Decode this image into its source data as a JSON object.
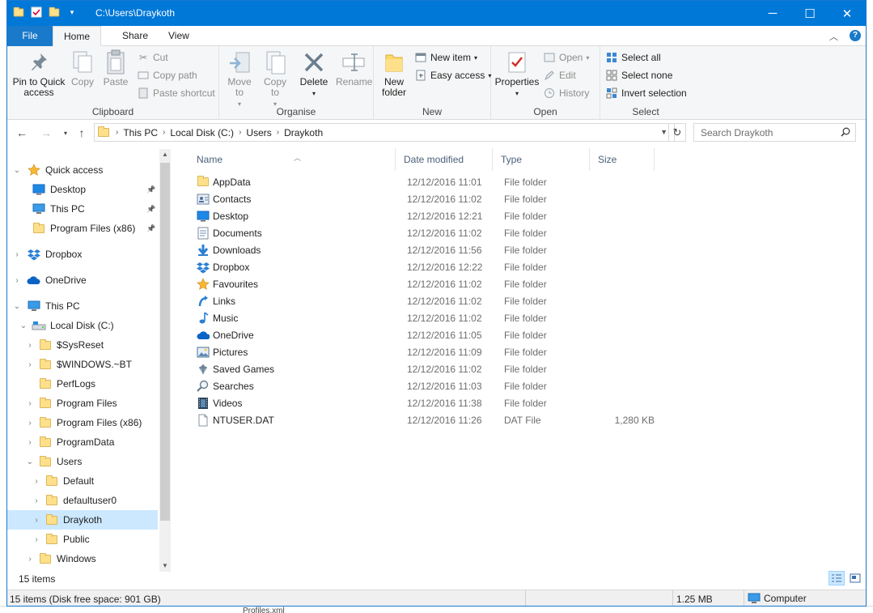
{
  "window": {
    "title": "C:\\Users\\Draykoth",
    "controls": {
      "minimize": "─",
      "maximize": "☐",
      "close": "✕"
    }
  },
  "ribbon_tabs": [
    "File",
    "Home",
    "Share",
    "View"
  ],
  "ribbon": {
    "clipboard": {
      "label": "Clipboard",
      "pin": "Pin to Quick access",
      "copy": "Copy",
      "paste": "Paste",
      "cut": "Cut",
      "copy_path": "Copy path",
      "paste_shortcut": "Paste shortcut"
    },
    "organise": {
      "label": "Organise",
      "move_to": "Move to",
      "copy_to": "Copy to",
      "delete": "Delete",
      "rename": "Rename"
    },
    "new": {
      "label": "New",
      "new_folder": "New folder",
      "new_item": "New item",
      "easy_access": "Easy access"
    },
    "open": {
      "label": "Open",
      "properties": "Properties",
      "open": "Open",
      "edit": "Edit",
      "history": "History"
    },
    "select": {
      "label": "Select",
      "select_all": "Select all",
      "select_none": "Select none",
      "invert": "Invert selection"
    }
  },
  "address": {
    "crumbs": [
      "This PC",
      "Local Disk (C:)",
      "Users",
      "Draykoth"
    ],
    "search_placeholder": "Search Draykoth"
  },
  "nav": [
    {
      "label": "Quick access",
      "icon": "star-icon",
      "level": 0,
      "arrow": "down"
    },
    {
      "label": "Desktop",
      "icon": "desktop-icon",
      "level": 1,
      "pin": true
    },
    {
      "label": "This PC",
      "icon": "computer-icon",
      "level": 1,
      "pin": true
    },
    {
      "label": "Program Files (x86)",
      "icon": "folder-icon",
      "level": 1,
      "pin": true
    },
    {
      "label": "Dropbox",
      "icon": "dropbox-icon",
      "level": 0,
      "arrow": "right"
    },
    {
      "label": "OneDrive",
      "icon": "onedrive-icon",
      "level": 0,
      "arrow": "right"
    },
    {
      "label": "This PC",
      "icon": "computer-icon",
      "level": 0,
      "arrow": "down"
    },
    {
      "label": "Local Disk (C:)",
      "icon": "drive-icon",
      "level": 1,
      "arrow": "down"
    },
    {
      "label": "$SysReset",
      "icon": "folder-icon",
      "level": 2,
      "arrow": "right"
    },
    {
      "label": "$WINDOWS.~BT",
      "icon": "folder-icon",
      "level": 2,
      "arrow": "right"
    },
    {
      "label": "PerfLogs",
      "icon": "folder-icon",
      "level": 2
    },
    {
      "label": "Program Files",
      "icon": "folder-icon",
      "level": 2,
      "arrow": "right"
    },
    {
      "label": "Program Files (x86)",
      "icon": "folder-icon",
      "level": 2,
      "arrow": "right"
    },
    {
      "label": "ProgramData",
      "icon": "folder-icon",
      "level": 2,
      "arrow": "right"
    },
    {
      "label": "Users",
      "icon": "folder-icon",
      "level": 2,
      "arrow": "down"
    },
    {
      "label": "Default",
      "icon": "folder-icon",
      "level": 3,
      "arrow": "right"
    },
    {
      "label": "defaultuser0",
      "icon": "folder-icon",
      "level": 3,
      "arrow": "right"
    },
    {
      "label": "Draykoth",
      "icon": "folder-icon",
      "level": 3,
      "arrow": "right",
      "selected": true
    },
    {
      "label": "Public",
      "icon": "folder-icon",
      "level": 3,
      "arrow": "right"
    },
    {
      "label": "Windows",
      "icon": "folder-icon",
      "level": 2,
      "arrow": "right"
    }
  ],
  "columns": {
    "name": "Name",
    "date": "Date modified",
    "type": "Type",
    "size": "Size"
  },
  "files": [
    {
      "name": "AppData",
      "date": "12/12/2016 11:01",
      "type": "File folder",
      "size": "",
      "icon": "folder-icon"
    },
    {
      "name": "Contacts",
      "date": "12/12/2016 11:02",
      "type": "File folder",
      "size": "",
      "icon": "contacts-icon"
    },
    {
      "name": "Desktop",
      "date": "12/12/2016 12:21",
      "type": "File folder",
      "size": "",
      "icon": "desktop-icon"
    },
    {
      "name": "Documents",
      "date": "12/12/2016 11:02",
      "type": "File folder",
      "size": "",
      "icon": "documents-icon"
    },
    {
      "name": "Downloads",
      "date": "12/12/2016 11:56",
      "type": "File folder",
      "size": "",
      "icon": "downloads-icon"
    },
    {
      "name": "Dropbox",
      "date": "12/12/2016 12:22",
      "type": "File folder",
      "size": "",
      "icon": "dropbox-icon"
    },
    {
      "name": "Favourites",
      "date": "12/12/2016 11:02",
      "type": "File folder",
      "size": "",
      "icon": "star-icon"
    },
    {
      "name": "Links",
      "date": "12/12/2016 11:02",
      "type": "File folder",
      "size": "",
      "icon": "links-icon"
    },
    {
      "name": "Music",
      "date": "12/12/2016 11:02",
      "type": "File folder",
      "size": "",
      "icon": "music-icon"
    },
    {
      "name": "OneDrive",
      "date": "12/12/2016 11:05",
      "type": "File folder",
      "size": "",
      "icon": "onedrive-icon"
    },
    {
      "name": "Pictures",
      "date": "12/12/2016 11:09",
      "type": "File folder",
      "size": "",
      "icon": "pictures-icon"
    },
    {
      "name": "Saved Games",
      "date": "12/12/2016 11:02",
      "type": "File folder",
      "size": "",
      "icon": "saved-games-icon"
    },
    {
      "name": "Searches",
      "date": "12/12/2016 11:03",
      "type": "File folder",
      "size": "",
      "icon": "search-icon"
    },
    {
      "name": "Videos",
      "date": "12/12/2016 11:38",
      "type": "File folder",
      "size": "",
      "icon": "videos-icon"
    },
    {
      "name": "NTUSER.DAT",
      "date": "12/12/2016 11:26",
      "type": "DAT File",
      "size": "1,280 KB",
      "icon": "file-icon"
    }
  ],
  "item_count": "15 items",
  "status": {
    "left": "15 items (Disk free space: 901 GB)",
    "size": "1.25 MB",
    "location": "Computer"
  },
  "background_text": "Profiles.xml"
}
